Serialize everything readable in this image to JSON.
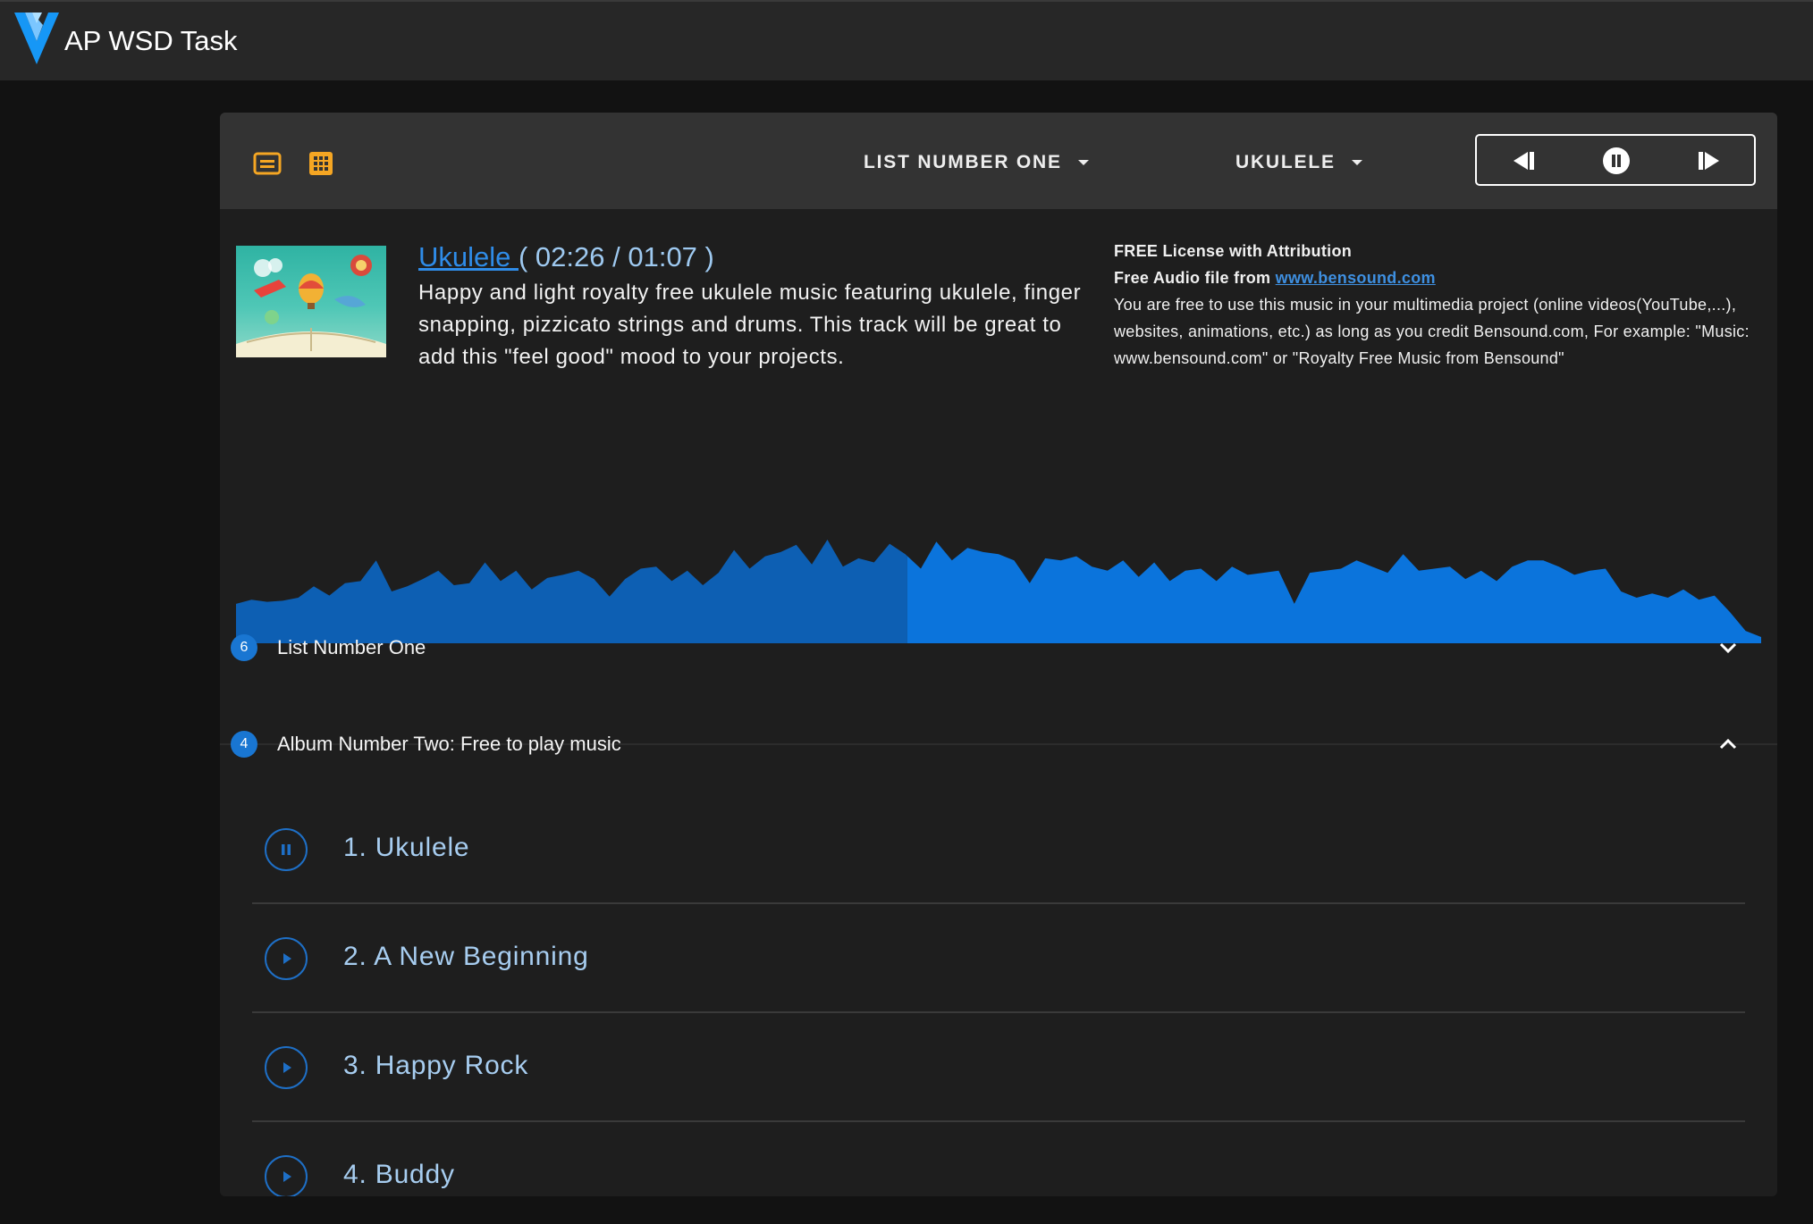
{
  "app": {
    "title": "AP WSD Task"
  },
  "toolbar": {
    "view_icons": [
      "list-view-icon",
      "grid-view-icon"
    ],
    "playlist_label": "LIST NUMBER ONE",
    "track_label": "UKULELE"
  },
  "now_playing": {
    "title": "Ukulele ",
    "time": "( 02:26 / 01:07 )",
    "description": "Happy and light royalty free ukulele music featuring ukulele, finger snapping, pizzicato strings and drums. This track will be great to add this \"feel good\" mood to your projects.",
    "progress": 0.44
  },
  "license": {
    "heading": "FREE License with Attribution",
    "source_prefix": "Free Audio file from ",
    "source_link": "www.bensound.com",
    "body": "You are free to use this music in your multimedia project (online videos(YouTube,...), websites, animations, etc.) as long as you credit Bensound.com, For example: \"Music: www.bensound.com\" or \"Royalty Free Music from Bensound\""
  },
  "groups": [
    {
      "count": "6",
      "label": "List Number One",
      "expanded": false
    },
    {
      "count": "4",
      "label": "Album Number Two: Free to play music",
      "expanded": true
    }
  ],
  "tracks": [
    {
      "label": "1. Ukulele",
      "state": "playing"
    },
    {
      "label": "2. A New Beginning",
      "state": "paused"
    },
    {
      "label": "3. Happy Rock",
      "state": "paused"
    },
    {
      "label": "4. Buddy",
      "state": "paused"
    }
  ],
  "colors": {
    "accent_orange": "#f5a623",
    "wave_played": "#0d5fb3",
    "wave_remaining": "#0b74dc",
    "badge": "#1976d2"
  }
}
